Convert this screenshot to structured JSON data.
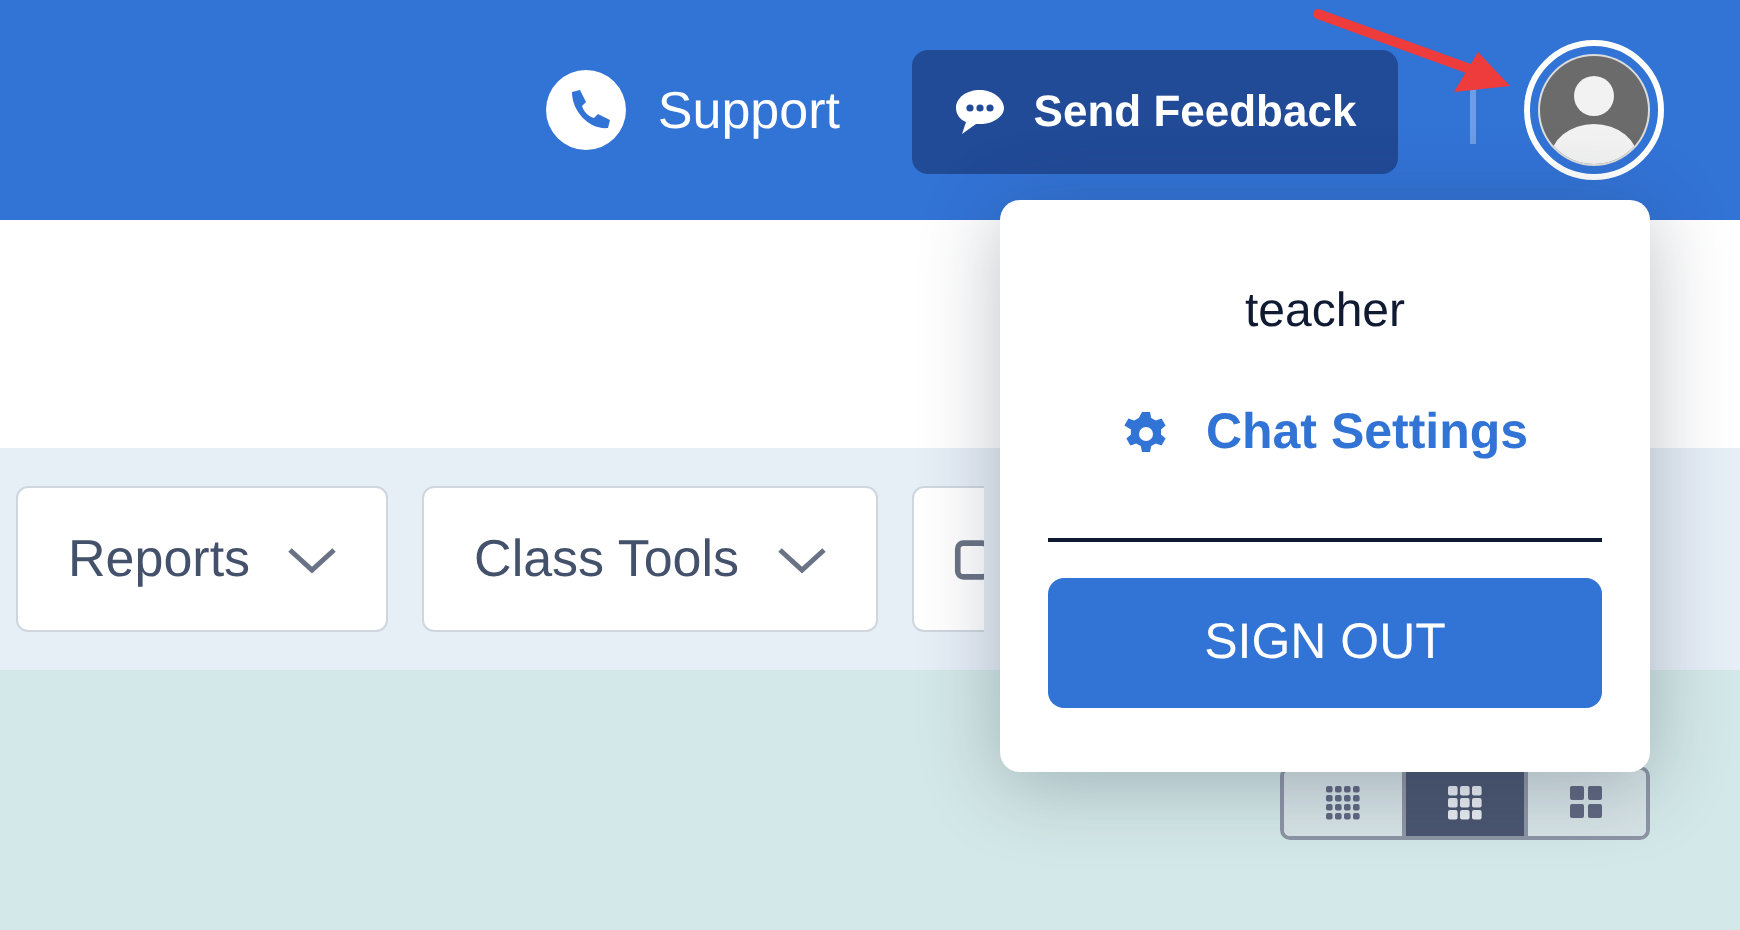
{
  "header": {
    "support": {
      "label": "Support"
    },
    "feedback_button": {
      "label": "Send Feedback"
    }
  },
  "toolbar": {
    "menus": [
      {
        "label": "Reports"
      },
      {
        "label": "Class Tools"
      }
    ]
  },
  "view_toggle": [
    {
      "kind": "small",
      "selected": false
    },
    {
      "kind": "medium",
      "selected": true
    },
    {
      "kind": "large",
      "selected": false
    }
  ],
  "user_menu": {
    "username": "teacher",
    "items": [
      {
        "label": "Chat Settings"
      }
    ],
    "sign_out": "SIGN OUT"
  }
}
